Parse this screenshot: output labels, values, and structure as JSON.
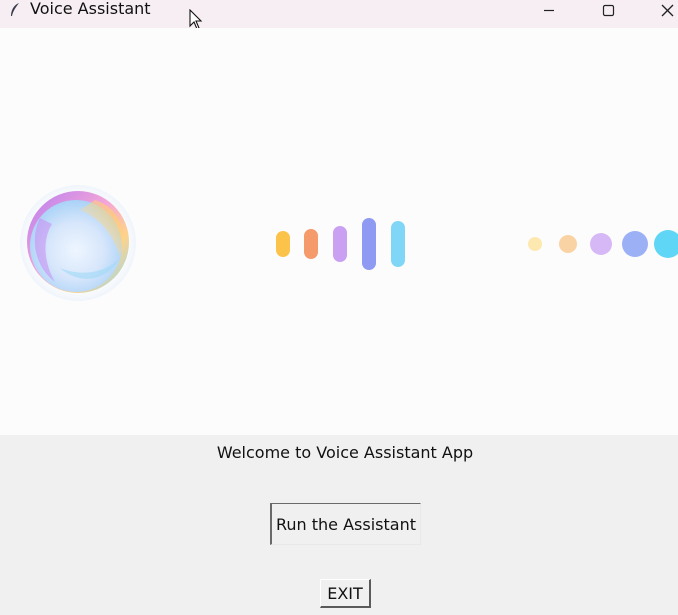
{
  "window": {
    "title": "Voice Assistant",
    "controls": [
      "minimize",
      "maximize",
      "close"
    ]
  },
  "banner": {
    "icons": [
      "voice-orb-icon",
      "sound-wave-bars-icon",
      "listening-dots-icon"
    ],
    "bar_colors": [
      "#fbc34a",
      "#f49a6b",
      "#c9a0f2",
      "#8f9bf2",
      "#7fd6f6"
    ],
    "dot_colors": [
      "#fde8b0",
      "#f9d3a4",
      "#d7b8f6",
      "#9cb0f6",
      "#5fd6f5"
    ]
  },
  "main": {
    "welcome_text": "Welcome to Voice Assistant App",
    "run_button_label": "Run the Assistant",
    "exit_button_label": "EXIT"
  }
}
